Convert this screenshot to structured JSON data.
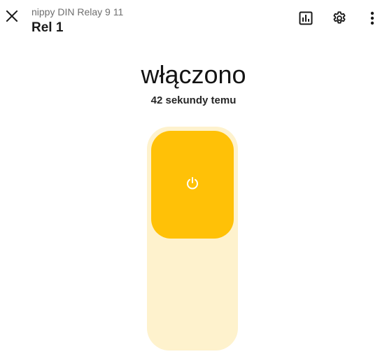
{
  "header": {
    "subtitle": "nippy DIN Relay 9 11",
    "title": "Rel 1",
    "close_icon": "close-icon",
    "history_icon": "chart-bar-icon",
    "settings_icon": "gear-icon",
    "menu_icon": "more-vertical-icon"
  },
  "state": {
    "label": "włączono",
    "last_changed": "42 sekundy temu",
    "is_on": true
  },
  "toggle": {
    "icon": "power-icon",
    "on_color": "#ffc107",
    "track_color": "#fef2cd"
  }
}
